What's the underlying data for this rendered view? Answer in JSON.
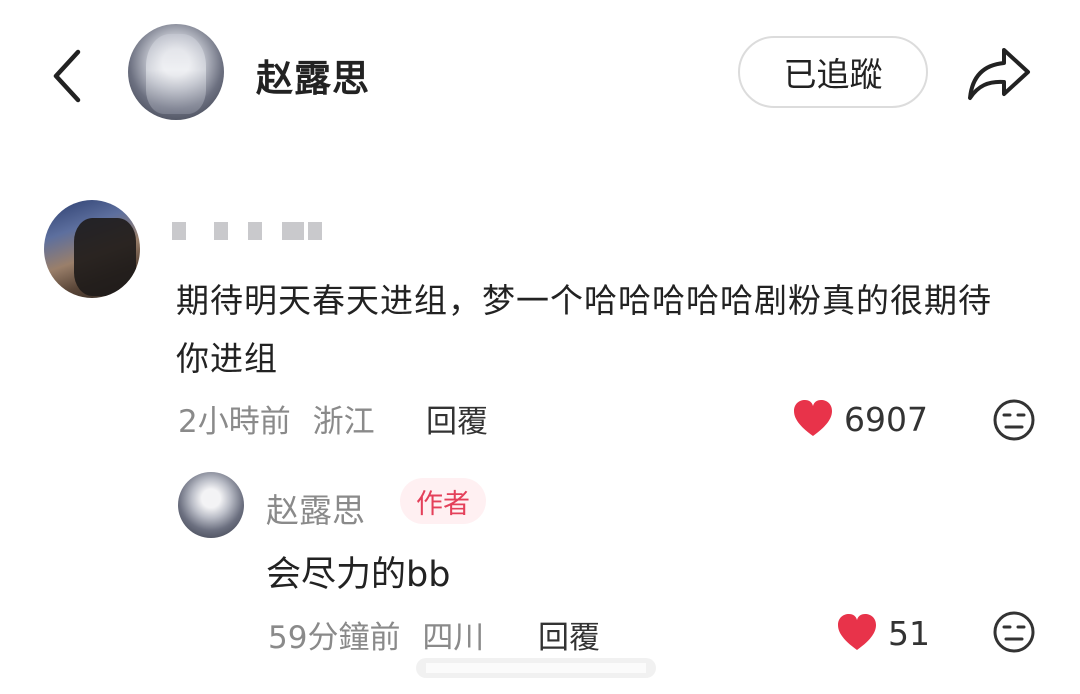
{
  "header": {
    "back_icon": "back-chevron-icon",
    "avatar_icon": "user-avatar",
    "name": "赵露思",
    "follow_label": "已追蹤",
    "share_icon": "share-arrow-icon"
  },
  "comment": {
    "avatar_icon": "user-avatar",
    "username_masked": "",
    "text": "期待明天春天进组，梦一个哈哈哈哈哈剧粉真的很期待你进组",
    "time": "2小時前",
    "location": "浙江",
    "reply_label": "回覆",
    "like_icon": "heart-icon",
    "likes": "6907",
    "emoji_icon": "neutral-face-icon",
    "heart_color": "#e8334a"
  },
  "reply": {
    "avatar_icon": "user-avatar",
    "name": "赵露思",
    "badge": "作者",
    "text": "会尽力的bb",
    "time": "59分鐘前",
    "location": "四川",
    "reply_label": "回覆",
    "like_icon": "heart-icon",
    "likes": "51",
    "emoji_icon": "neutral-face-icon"
  }
}
